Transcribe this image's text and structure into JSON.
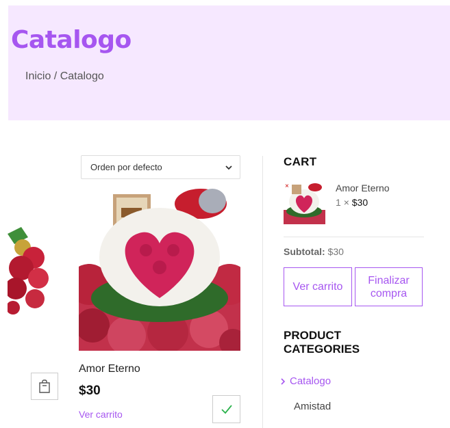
{
  "header": {
    "title": "Catalogo",
    "breadcrumb": "Inicio / Catalogo"
  },
  "sort": {
    "selected": "Orden por defecto",
    "icon": "chevron-down-icon"
  },
  "product": {
    "name": "Amor Eterno",
    "price": "$30",
    "view_cart_link": "Ver carrito"
  },
  "cart": {
    "heading": "CART",
    "item": {
      "name": "Amor Eterno",
      "quantity": "1",
      "multiplier": "×",
      "price": "$30",
      "remove_icon": "×"
    },
    "subtotal_label": "Subtotal:",
    "subtotal_value": "$30",
    "view_cart_button": "Ver carrito",
    "checkout_button": "Finalizar compra"
  },
  "categories": {
    "heading": "PRODUCT CATEGORIES",
    "items": [
      {
        "label": "Catalogo",
        "active": true
      },
      {
        "label": "Amistad",
        "active": false
      }
    ]
  },
  "colors": {
    "accent": "#a656f0",
    "header_bg": "#f6e8ff"
  }
}
